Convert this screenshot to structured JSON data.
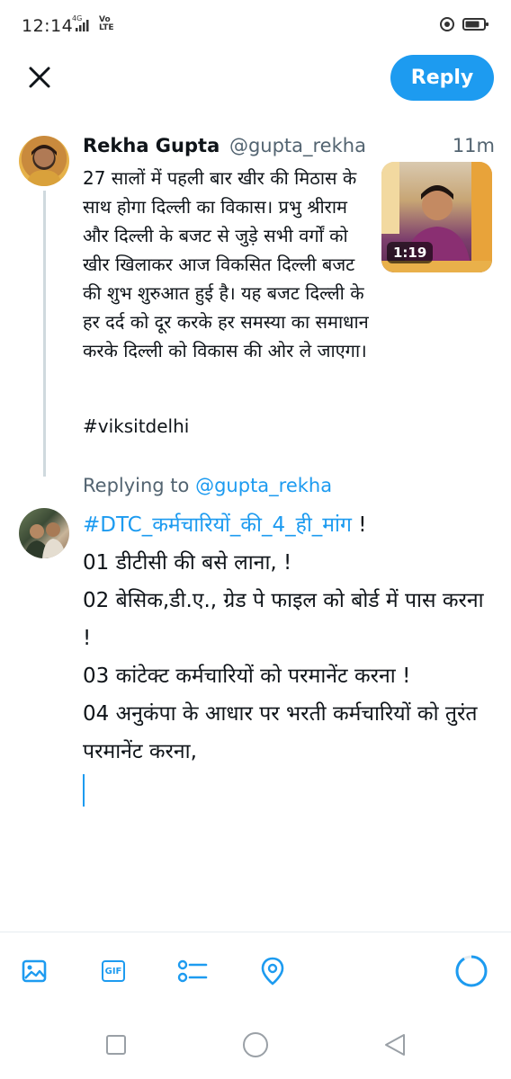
{
  "status_bar": {
    "time": "12:14",
    "network": "4G",
    "carrier_badge": "Vo LTE"
  },
  "header": {
    "reply_label": "Reply"
  },
  "original_tweet": {
    "name": "Rekha Gupta",
    "handle": "@gupta_rekha",
    "time": "11m",
    "text": "27 सालों में पहली बार खीर की मिठास के साथ होगा दिल्ली का विकास। प्रभु श्रीराम और दिल्ली के बजट से जुड़े सभी वर्गों को खीर खिलाकर आज विकसित दिल्ली बजट की शुभ शुरुआत हुई है। यह बजट दिल्ली के हर दर्द को दूर करके हर समस्या का समाधान करके दिल्ली को विकास की ओर ले जाएगा।",
    "hashtag": "#viksitdelhi",
    "media_duration": "1:19"
  },
  "replying_to": {
    "prefix": "Replying to",
    "handle": "@gupta_rekha"
  },
  "compose": {
    "hashtag": "#DTC_कर्मचारियों_की_4_ही_मांग",
    "hashtag_suffix": " !",
    "lines": [
      "01 डीटीसी की बसे लाना, !",
      "02  बेसिक,डी.ए., ग्रेड पे फाइल को बोर्ड में पास करना !",
      "03 कांटेक्ट कर्मचारियों को परमानेंट करना !",
      "04 अनुकंपा के आधार पर भरती कर्मचारियों को तुरंत परमानेंट करना,"
    ]
  },
  "toolbar": {
    "gif_label": "GIF",
    "icons": [
      "image-icon",
      "gif-icon",
      "poll-icon",
      "location-icon",
      "character-count-icon"
    ],
    "accent": "#1d9bf0"
  },
  "nav": {
    "icons": [
      "recents-icon",
      "home-icon",
      "back-icon"
    ]
  }
}
